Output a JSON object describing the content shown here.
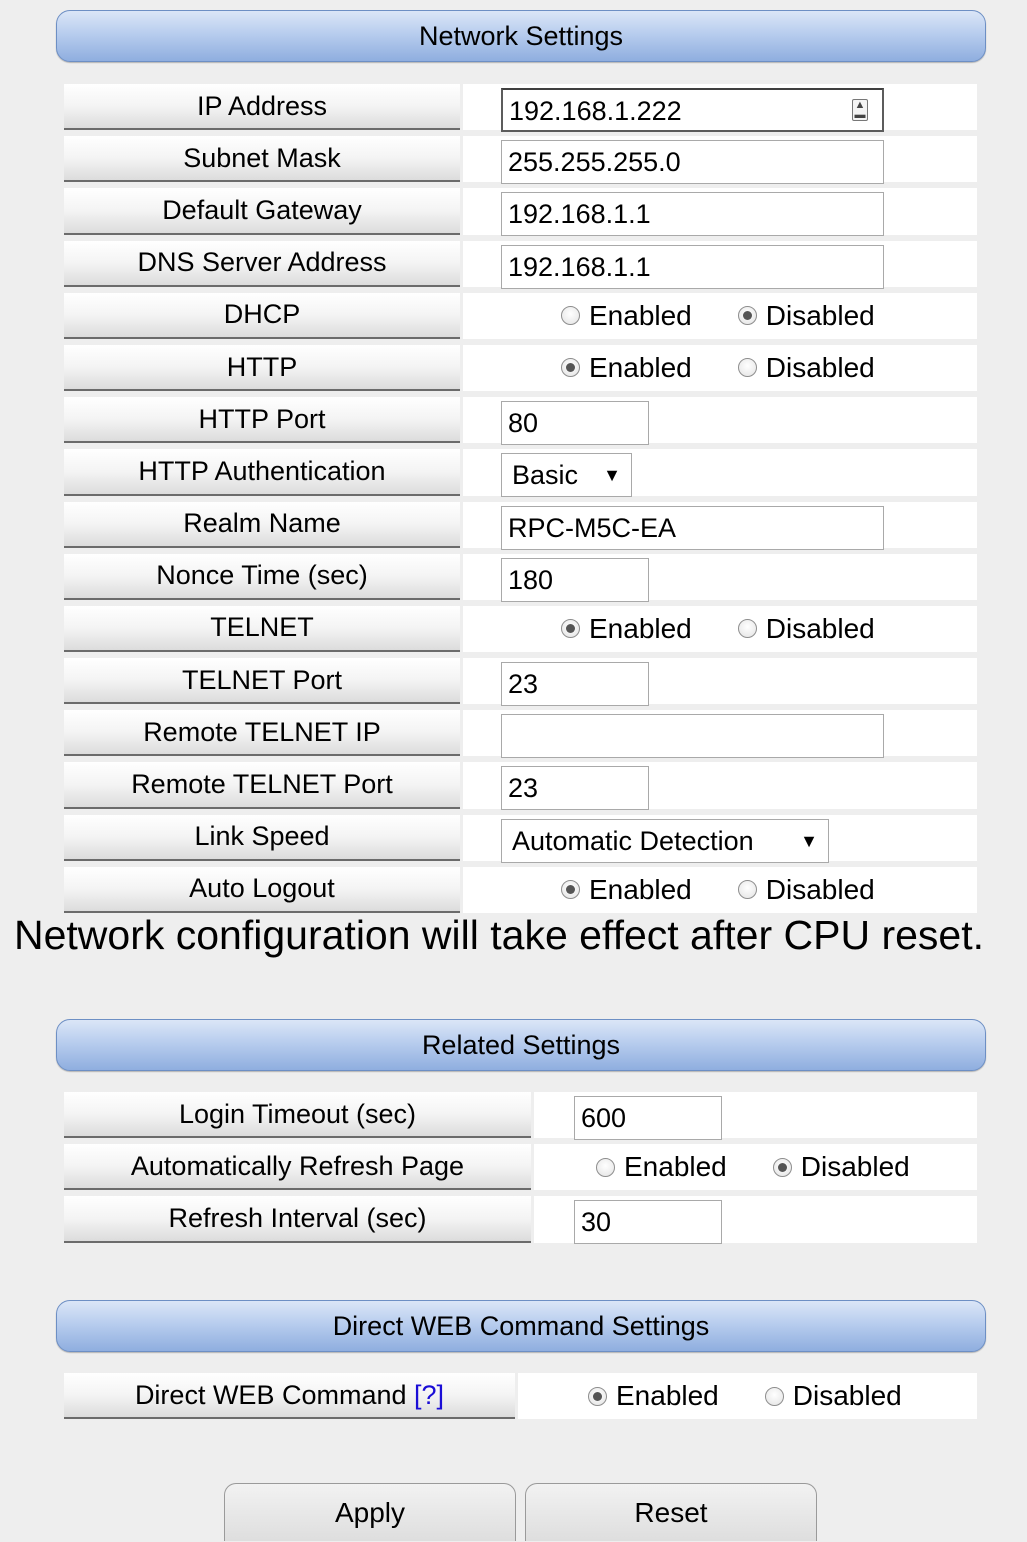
{
  "network": {
    "title": "Network Settings",
    "rows": {
      "ip": {
        "label": "IP Address",
        "value": "192.168.1.222"
      },
      "subnet": {
        "label": "Subnet Mask",
        "value": "255.255.255.0"
      },
      "gateway": {
        "label": "Default Gateway",
        "value": "192.168.1.1"
      },
      "dns": {
        "label": "DNS Server Address",
        "value": "192.168.1.1"
      },
      "dhcp": {
        "label": "DHCP",
        "opt1": "Enabled",
        "opt2": "Disabled",
        "selected": "Disabled"
      },
      "http": {
        "label": "HTTP",
        "opt1": "Enabled",
        "opt2": "Disabled",
        "selected": "Enabled"
      },
      "http_port": {
        "label": "HTTP Port",
        "value": "80"
      },
      "http_auth": {
        "label": "HTTP Authentication",
        "value": "Basic"
      },
      "realm": {
        "label": "Realm Name",
        "value": "RPC-M5C-EA"
      },
      "nonce": {
        "label": "Nonce Time (sec)",
        "value": "180"
      },
      "telnet": {
        "label": "TELNET",
        "opt1": "Enabled",
        "opt2": "Disabled",
        "selected": "Enabled"
      },
      "telnet_port": {
        "label": "TELNET Port",
        "value": "23"
      },
      "remote_ip": {
        "label": "Remote TELNET IP",
        "value": ""
      },
      "remote_port": {
        "label": "Remote TELNET Port",
        "value": "23"
      },
      "link_speed": {
        "label": "Link Speed",
        "value": "Automatic Detection"
      },
      "auto_logout": {
        "label": "Auto Logout",
        "opt1": "Enabled",
        "opt2": "Disabled",
        "selected": "Enabled"
      }
    }
  },
  "notice": "Network configuration will take effect after CPU reset.",
  "related": {
    "title": "Related Settings",
    "rows": {
      "login_timeout": {
        "label": "Login Timeout (sec)",
        "value": "600"
      },
      "auto_refresh": {
        "label": "Automatically Refresh Page",
        "opt1": "Enabled",
        "opt2": "Disabled",
        "selected": "Disabled"
      },
      "refresh_interval": {
        "label": "Refresh Interval (sec)",
        "value": "30"
      }
    }
  },
  "direct": {
    "title": "Direct WEB Command Settings",
    "rows": {
      "direct_cmd": {
        "label": "Direct WEB Command",
        "help": "[?]",
        "opt1": "Enabled",
        "opt2": "Disabled",
        "selected": "Enabled"
      }
    }
  },
  "buttons": {
    "apply": "Apply",
    "reset": "Reset"
  }
}
